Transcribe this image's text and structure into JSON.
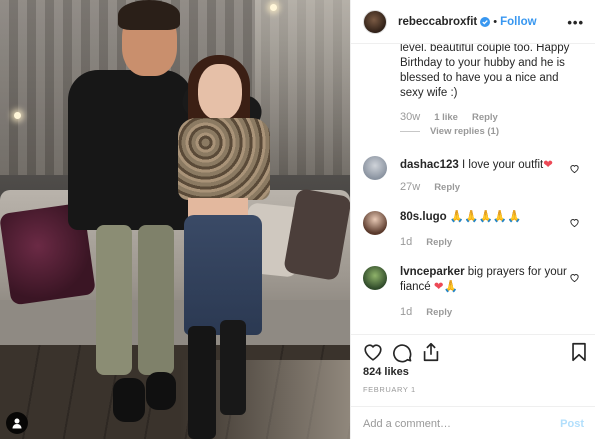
{
  "header": {
    "username": "rebeccabroxfit",
    "separator": "•",
    "follow_label": "Follow",
    "more_icon": "more-horizontal-icon"
  },
  "comments": {
    "continued": {
      "text": "level. beautiful couple too. Happy Birthday to your hubby and he is blessed to have you a nice and sexy wife :)",
      "time": "30w",
      "likes": "1 like",
      "reply": "Reply",
      "view_replies": "View replies (1)"
    },
    "items": [
      {
        "username": "dashac123",
        "text": "I love your outfit",
        "emoji": "❤",
        "time": "27w",
        "reply": "Reply"
      },
      {
        "username": "80s.lugo",
        "text": "",
        "emoji": "🙏🙏🙏🙏🙏",
        "time": "1d",
        "reply": "Reply"
      },
      {
        "username": "lvnceparker",
        "text": "big prayers for your fiancé",
        "emoji": "❤🙏",
        "time": "1d",
        "reply": "Reply"
      }
    ]
  },
  "actions": {
    "likes": "824 likes",
    "date": "FEBRUARY 1",
    "icons": [
      "heart-icon",
      "comment-icon",
      "share-icon",
      "bookmark-icon"
    ]
  },
  "add_comment": {
    "placeholder": "Add a comment…",
    "post_label": "Post"
  },
  "colors": {
    "accent": "#3897f0",
    "post_disabled": "#b2dffc",
    "secondary_text": "#999999",
    "heart_red": "#ed4956"
  }
}
